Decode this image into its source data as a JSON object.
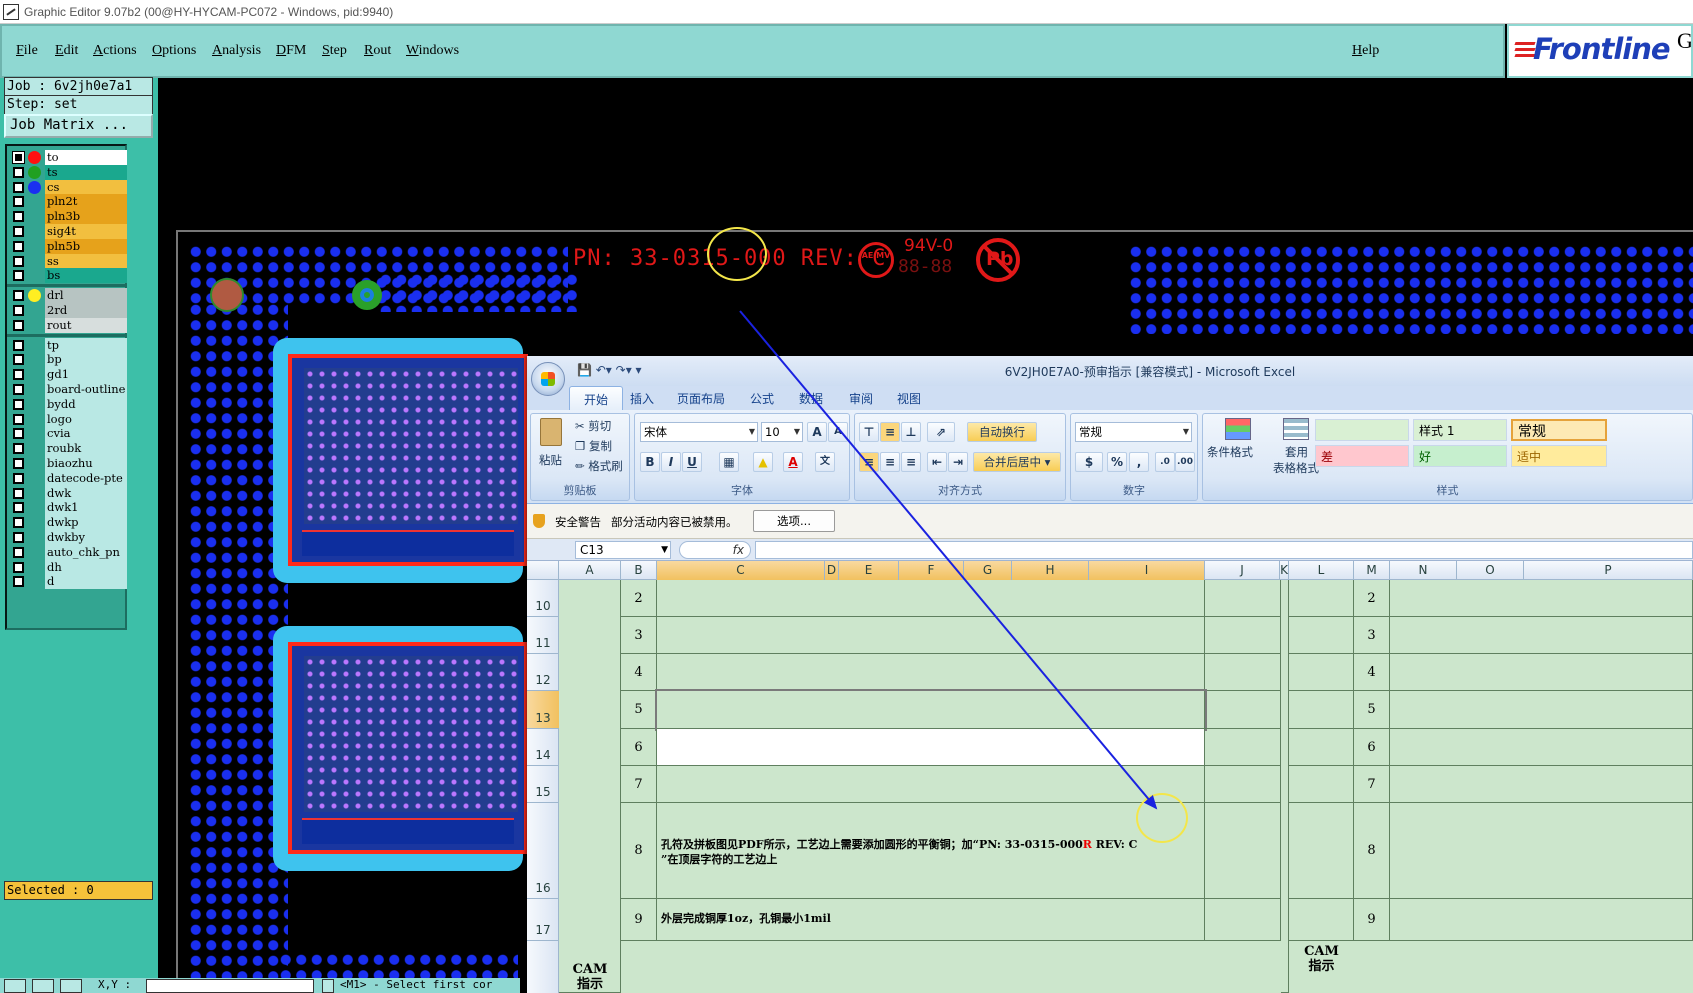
{
  "window": {
    "title": "Graphic Editor 9.07b2 (00@HY-HYCAM-PC072 - Windows, pid:9940)"
  },
  "menu": {
    "items": [
      "File",
      "Edit",
      "Actions",
      "Options",
      "Analysis",
      "DFM",
      "Step",
      "Rout",
      "Windows"
    ],
    "help": "Help"
  },
  "brand": {
    "logo": "Frontline",
    "trailing": "G"
  },
  "job": {
    "job_label": "Job : 6v2jh0e7a1",
    "step_label": "Step: set",
    "matrix_button": "Job Matrix ..."
  },
  "layers": {
    "group1": [
      {
        "name": "to",
        "color": "#ffffff",
        "dot": "#ff1010",
        "active": true
      },
      {
        "name": "ts",
        "color": "#1aa88e",
        "dot": "#20a020"
      },
      {
        "name": "cs",
        "color": "#f2bf3f",
        "dot": "#1a2ff0"
      },
      {
        "name": "pln2t",
        "color": "#e6a21b",
        "dot": ""
      },
      {
        "name": "pln3b",
        "color": "#e6a21b",
        "dot": ""
      },
      {
        "name": "sig4t",
        "color": "#f2bf3f",
        "dot": ""
      },
      {
        "name": "pln5b",
        "color": "#e6a21b",
        "dot": ""
      },
      {
        "name": "ss",
        "color": "#f2bf3f",
        "dot": ""
      },
      {
        "name": "bs",
        "color": "#1aa88e",
        "dot": ""
      }
    ],
    "group2": [
      {
        "name": "drl",
        "color": "#b7c4c2",
        "dot": "#ffee22"
      },
      {
        "name": "2rd",
        "color": "#b7c4c2",
        "dot": ""
      },
      {
        "name": "rout",
        "color": "#d7dedd",
        "dot": ""
      }
    ],
    "group3": [
      "tp",
      "bp",
      "gd1",
      "board-outline",
      "bydd",
      "logo",
      "cvia",
      "roubk",
      "biaozhu",
      "datecode-pte",
      "dwk",
      "dwk1",
      "dwkp",
      "dwkby",
      "auto_chk_pn",
      "dh",
      "d"
    ],
    "group3_color": "#b9e8e4"
  },
  "selected": "Selected : 0",
  "status": {
    "coord_label": "X,Y :",
    "message": "<M1> - Select first cor"
  },
  "pcb": {
    "pn_text": "PN: 33-0315-000 REV: C",
    "rating": "94V-0",
    "date_code": "88-88",
    "cert": "AE MV",
    "pb_mark": "Pb"
  },
  "excel": {
    "title": "6V2JH0E7A0-预审指示  [兼容模式] - Microsoft Excel",
    "tabs": [
      "开始",
      "插入",
      "页面布局",
      "公式",
      "数据",
      "审阅",
      "视图"
    ],
    "active_tab": "开始",
    "clipboard": {
      "paste": "粘贴",
      "cut": "剪切",
      "copy": "复制",
      "format_painter": "格式刷",
      "group": "剪贴板"
    },
    "font": {
      "name": "宋体",
      "size": "10",
      "group": "字体"
    },
    "alignment": {
      "wrap": "自动换行",
      "merge": "合并后居中",
      "group": "对齐方式"
    },
    "number": {
      "format": "常规",
      "group": "数字"
    },
    "styles": {
      "cond_format": "条件格式",
      "table_format_1": "套用",
      "table_format_2": "表格格式",
      "cells": [
        {
          "label": "",
          "bg": "#d9f0d3"
        },
        {
          "label": "样式 1",
          "bg": "#d9f0d3"
        },
        {
          "label": "常规",
          "bg": "#fde9b4"
        },
        {
          "label": "差",
          "bg": "#ffc7ce",
          "fg": "#9c0006"
        },
        {
          "label": "好",
          "bg": "#c6efce",
          "fg": "#006100"
        },
        {
          "label": "适中",
          "bg": "#ffeb9c",
          "fg": "#9c6500"
        }
      ],
      "group": "样式"
    },
    "security": {
      "label": "安全警告",
      "message": "部分活动内容已被禁用。",
      "options": "选项..."
    },
    "namebox": "C13",
    "fx": "fx",
    "columns": [
      "A",
      "B",
      "C",
      "D",
      "E",
      "F",
      "G",
      "H",
      "I",
      "J",
      "K",
      "L",
      "M",
      "N",
      "O",
      "P"
    ],
    "rows": [
      "10",
      "11",
      "12",
      "13",
      "14",
      "15",
      "16",
      "17"
    ],
    "selected_row": "13",
    "b_numbers": [
      "2",
      "3",
      "4",
      "5",
      "6",
      "7",
      "8",
      "9"
    ],
    "row8_text_a": "孔符及拼板图见PDF所示，工艺边上需要添加圆形的平衡铜；加“PN: 33-031",
    "row8_text_b": "5-000",
    "row8_text_r": "R",
    "row8_text_c": " REV: C",
    "row8_text_line2": "”在顶层字符的工艺边上",
    "row9_text": "外层完成铜厚1oz，孔铜最小1mil",
    "side_label_1": "CAM",
    "side_label_2": "指示"
  }
}
